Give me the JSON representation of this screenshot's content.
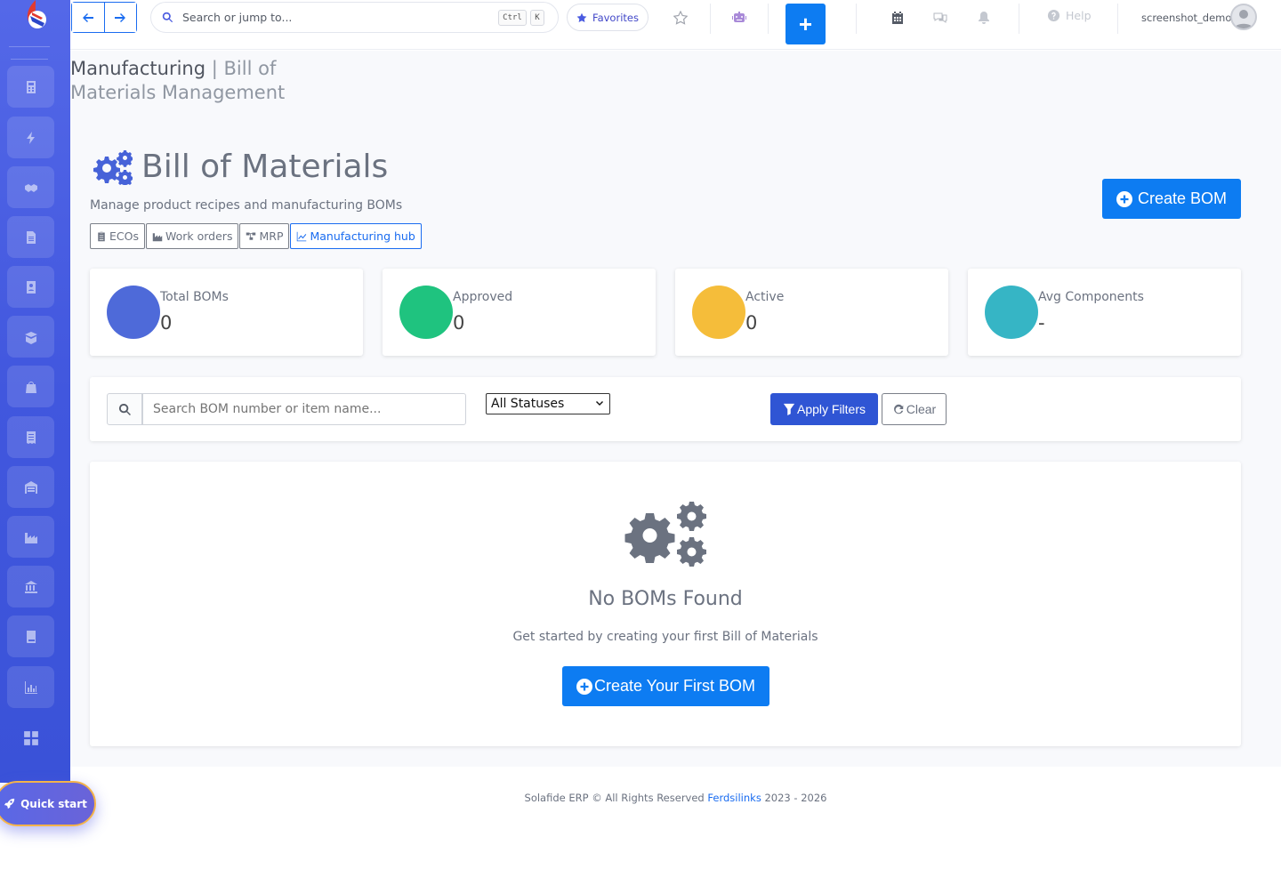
{
  "topbar": {
    "search_placeholder": "Search or jump to...",
    "kbd_ctrl": "Ctrl",
    "kbd_k": "K",
    "favorites_label": "Favorites",
    "help_label": "Help",
    "username": "screenshot_demo",
    "add_label": "+"
  },
  "breadcrumb": {
    "section": "Manufacturing",
    "separator": " | ",
    "page": "Bill of Materials Management"
  },
  "header": {
    "title": "Bill of Materials",
    "subtitle": "Manage product recipes and manufacturing BOMs",
    "create_label": "Create BOM"
  },
  "chips": [
    {
      "label": "ECOs",
      "icon": "clipboard-icon"
    },
    {
      "label": "Work orders",
      "icon": "industry-icon"
    },
    {
      "label": "MRP",
      "icon": "sitemap-icon"
    },
    {
      "label": "Manufacturing hub",
      "icon": "chart-line-icon",
      "active": true
    }
  ],
  "stats": [
    {
      "label": "Total BOMs",
      "value": "0",
      "color": "#4e6ad9"
    },
    {
      "label": "Approved",
      "value": "0",
      "color": "#1fc37f"
    },
    {
      "label": "Active",
      "value": "0",
      "color": "#f5bd3a"
    },
    {
      "label": "Avg Components",
      "value": "-",
      "color": "#36b5c5"
    }
  ],
  "filters": {
    "search_placeholder": "Search BOM number or item name...",
    "status_selected": "All Statuses",
    "apply_label": "Apply Filters",
    "clear_label": "Clear"
  },
  "empty_state": {
    "title": "No BOMs Found",
    "subtitle": "Get started by creating your first Bill of Materials",
    "button_label": "Create Your First BOM"
  },
  "footer": {
    "prefix": "Solafide ERP © All Rights Reserved ",
    "link": "Ferdsilinks",
    "suffix": " 2023 - 2026"
  },
  "quick_start_label": "Quick start",
  "colors": {
    "accent": "#0d7cf2",
    "sidebar": "#4157de"
  }
}
